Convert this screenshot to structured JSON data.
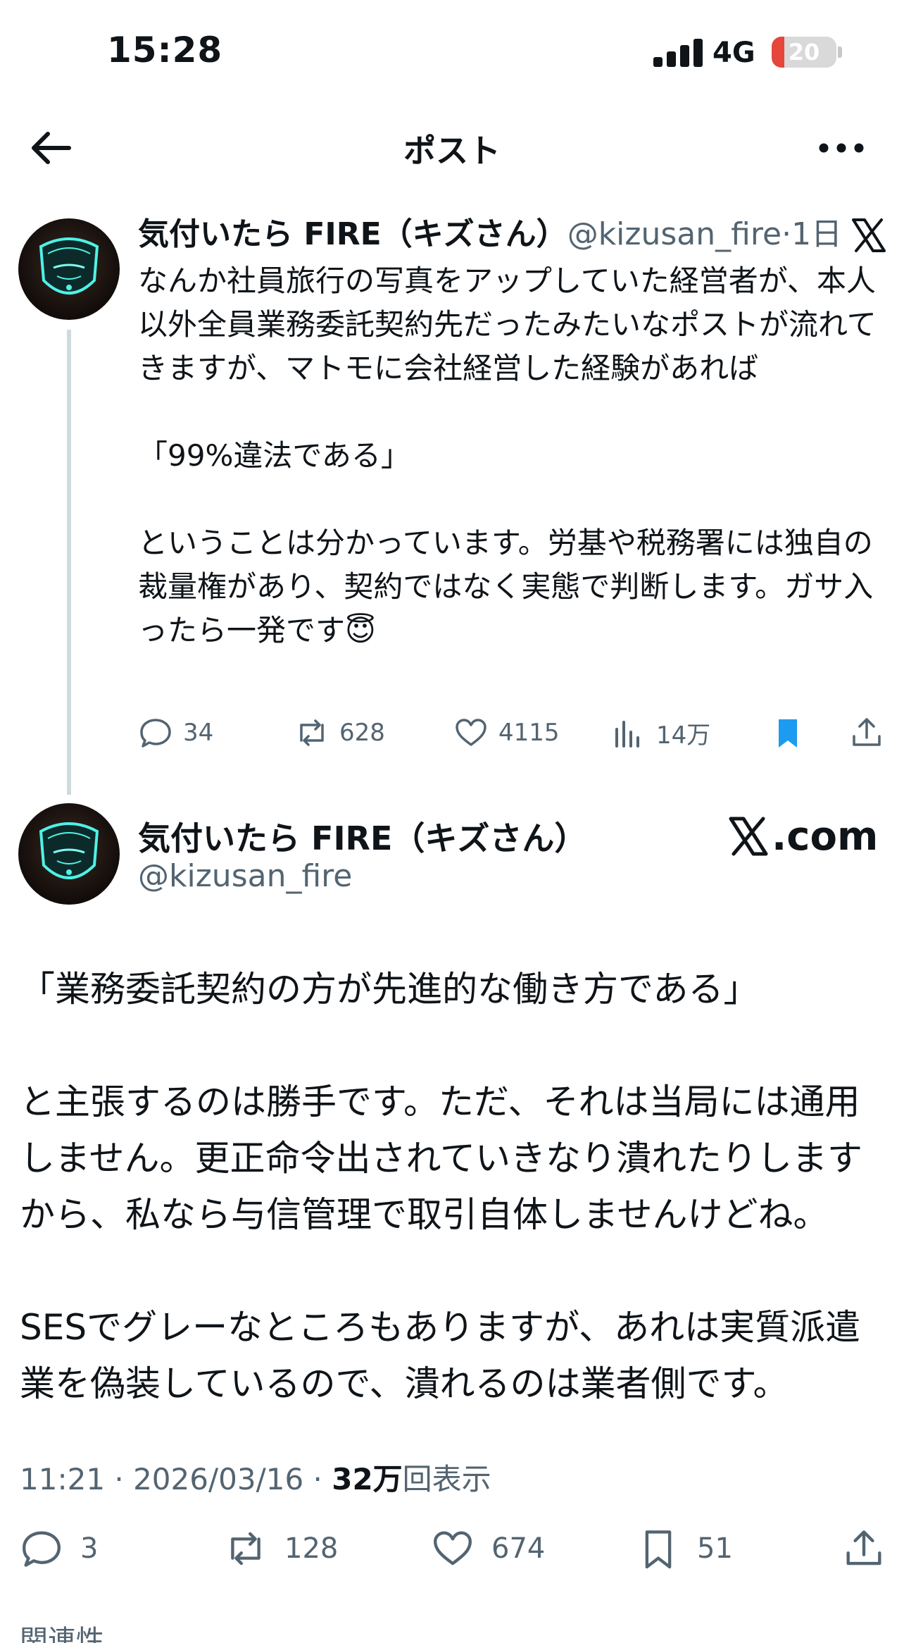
{
  "status_bar": {
    "time": "15:28",
    "network": "4G",
    "battery": "20",
    "battery_level": 0.2,
    "battery_color": "#e5453a"
  },
  "nav": {
    "title": "ポスト",
    "back_icon": "arrow-left-icon",
    "more_icon": "more-dots-icon"
  },
  "quoted_post": {
    "display_name": "気付いたら FIRE（キズさん）",
    "handle": "@kizusan_fire",
    "separator": "·",
    "time": "1日",
    "platform_icon": "x-logo-icon",
    "text": "なんか社員旅行の写真をアップしていた経営者が、本人以外全員業務委託契約先だったみたいなポストが流れてきますが、マトモに会社経営した経験があれば\n\n「99%違法である」\n\nということは分かっています。労基や税務署には独自の裁量権があり、契約ではなく実態で判断します。ガサ入ったら一発です😇",
    "actions": {
      "replies": "34",
      "reposts": "628",
      "likes": "4115",
      "views": "14万",
      "bookmark_color": "#1d9bf0"
    }
  },
  "main_post": {
    "display_name": "気付いたら FIRE（キズさん）",
    "handle": "@kizusan_fire",
    "watermark": ".com",
    "text": "「業務委託契約の方が先進的な働き方である」\n\nと主張するのは勝手です。ただ、それは当局には通用しません。更正命令出されていきなり潰れたりしますから、私なら与信管理で取引自体しませんけどね。\n\nSESでグレーなところもありますが、あれは実質派遣業を偽装しているので、潰れるのは業者側です。",
    "timestamp": "11:21 · 2026/03/16 · ",
    "views_count": "32万",
    "views_label": "回表示",
    "actions": {
      "replies": "3",
      "reposts": "128",
      "likes": "674",
      "bookmarks": "51"
    },
    "related_label": "関連性"
  }
}
